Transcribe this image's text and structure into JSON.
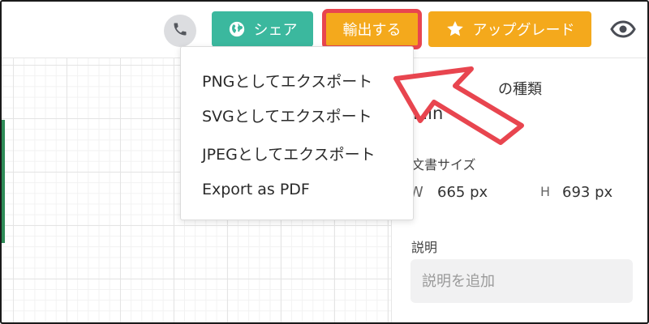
{
  "toolbar": {
    "share_label": "シェア",
    "export_label": "輸出する",
    "upgrade_label": "アップグレード"
  },
  "export_menu": {
    "items": [
      {
        "label": "PNGとしてエクスポート"
      },
      {
        "label": "SVGとしてエクスポート"
      },
      {
        "label": "JPEGとしてエクスポート"
      },
      {
        "label": "Export as PDF"
      }
    ]
  },
  "panel": {
    "type_label_partial": "の種類",
    "type_value_partial": "Min",
    "doc_size_label": "文書サイズ",
    "width_label": "W",
    "width_value": "665 px",
    "height_label": "H",
    "height_value": "693 px",
    "description_label": "説明",
    "description_placeholder": "説明を追加"
  },
  "colors": {
    "share": "#3bb89e",
    "export": "#f4a91c",
    "upgrade": "#f4a91c",
    "highlight": "#e8454f",
    "arrow": "#e8454f"
  },
  "icons": {
    "phone": "phone-icon",
    "globe": "globe-icon",
    "star": "star-icon",
    "eye": "eye-icon"
  }
}
